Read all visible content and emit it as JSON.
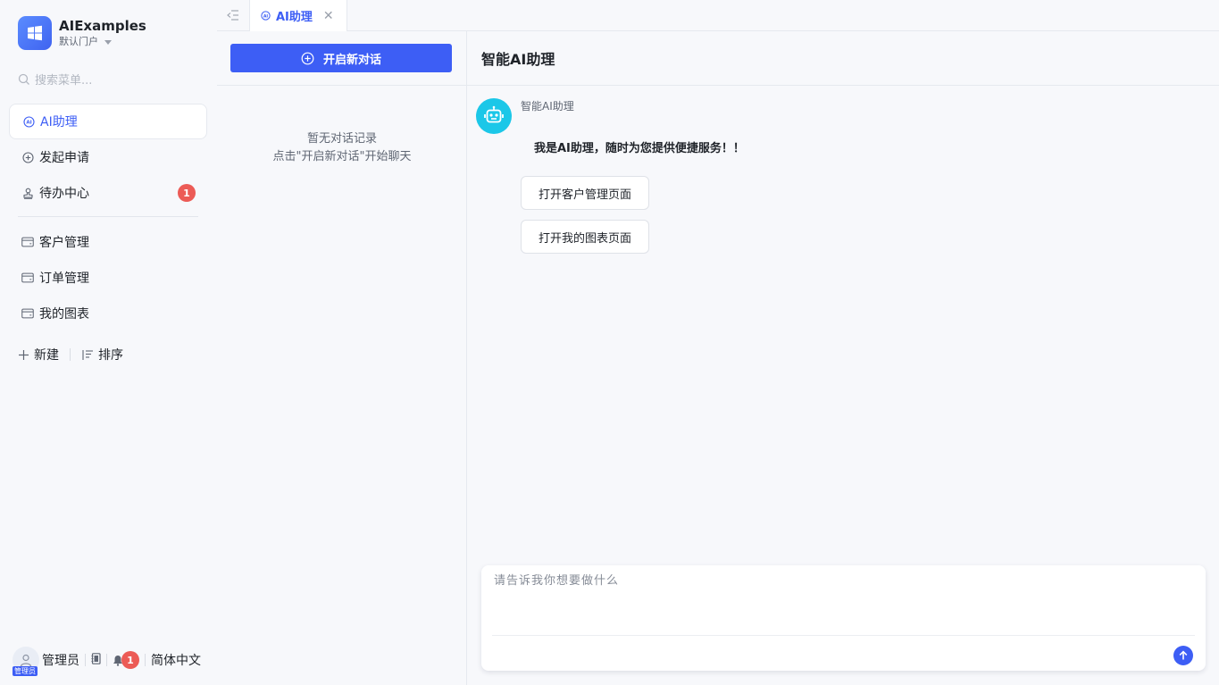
{
  "brand": {
    "title": "AIExamples",
    "subtitle": "默认门户"
  },
  "search": {
    "placeholder": "搜索菜单..."
  },
  "menu": {
    "items": [
      {
        "label": "AI助理",
        "icon": "ai-icon",
        "active": true
      },
      {
        "label": "发起申请",
        "icon": "plus-circle-icon"
      },
      {
        "label": "待办中心",
        "icon": "stamp-icon",
        "badge": "1"
      }
    ],
    "groups": [
      {
        "label": "客户管理",
        "icon": "card-icon"
      },
      {
        "label": "订单管理",
        "icon": "card-icon"
      },
      {
        "label": "我的图表",
        "icon": "card-icon"
      }
    ],
    "new_label": "新建",
    "sort_label": "排序"
  },
  "footer": {
    "user": "管理员",
    "avatar_tag": "管理员",
    "notify_count": "1",
    "language": "简体中文"
  },
  "tabs": [
    {
      "label": "AI助理"
    }
  ],
  "history": {
    "new_chat_label": "开启新对话",
    "empty_line1": "暂无对话记录",
    "empty_line2": "点击\"开启新对话\"开始聊天"
  },
  "chat": {
    "title": "智能AI助理",
    "bot_name": "智能AI助理",
    "bot_message": "我是AI助理，随时为您提供便捷服务！！",
    "actions": [
      "打开客户管理页面",
      "打开我的图表页面"
    ],
    "input_placeholder": "请告诉我你想要做什么"
  },
  "colors": {
    "accent": "#3d5ef5",
    "badge": "#ec5b56",
    "bot": "#1bc7e8"
  }
}
